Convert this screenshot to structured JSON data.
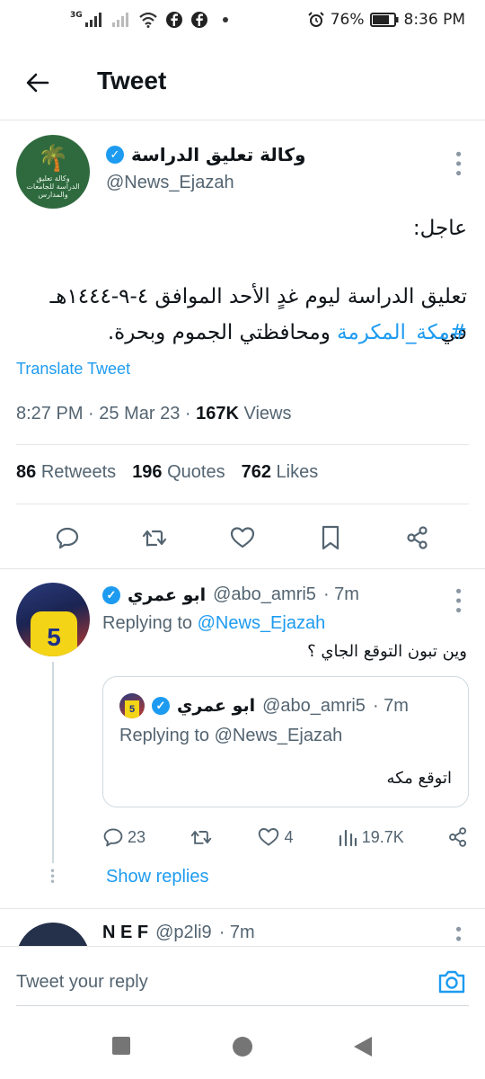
{
  "status_bar": {
    "network": "3G",
    "battery": "76%",
    "time": "8:36 PM"
  },
  "header": {
    "title": "Tweet"
  },
  "tweet": {
    "author_name": "وكالة تعليق الدراسة",
    "author_handle": "@News_Ejazah",
    "avatar_text": "وكالة تعليق الدراسة للجامعات والمدارس",
    "line1": "عاجل:",
    "line2": "تعليق الدراسة ليوم غدٍ الأحد الموافق ٤-٩-١٤٤٤هـ في",
    "hashtag": "#مكة_المكرمة",
    "line3_rest": " ومحافظتي الجموم وبحرة.",
    "translate": "Translate Tweet",
    "time": "8:27 PM",
    "date": "25 Mar 23",
    "views_count": "167K",
    "views_label": "Views",
    "retweets_count": "86",
    "retweets_label": "Retweets",
    "quotes_count": "196",
    "quotes_label": "Quotes",
    "likes_count": "762",
    "likes_label": "Likes"
  },
  "reply": {
    "name": "ابو عمري",
    "handle": "@abo_amri5",
    "age": "· 7m",
    "replying_prefix": "Replying to",
    "replying_to": "@News_Ejazah",
    "text": "وين تبون التوقع الجاي ؟",
    "jersey": "5",
    "quote": {
      "name": "ابو عمري",
      "handle": "@abo_amri5",
      "age": "· 7m",
      "replying": "Replying to @News_Ejazah",
      "text": "اتوقع مكه"
    },
    "replies_count": "23",
    "likes_count": "4",
    "views_count": "19.7K",
    "show_replies": "Show replies"
  },
  "next_reply": {
    "name": "N E F",
    "handle": "@p2li9",
    "age": "· 7m"
  },
  "composer": {
    "placeholder": "Tweet your reply"
  },
  "colors": {
    "accent": "#1d9bf0",
    "text": "#0f1419",
    "muted": "#536471"
  }
}
